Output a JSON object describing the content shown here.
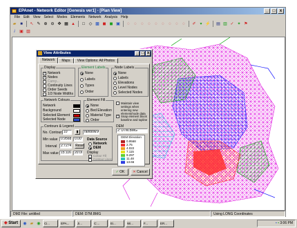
{
  "window": {
    "title": "EPAnet - Network Editor [Genesis ver1] - [Plan View]",
    "buttons": [
      "_",
      "□",
      "x"
    ]
  },
  "menu": [
    "File",
    "Edit",
    "View",
    "Select",
    "Modes",
    "Elements",
    "Network",
    "Analysis",
    "Help"
  ],
  "statusbar": {
    "file": "DM2 File: untitled",
    "dem": "DEM: D7M.BMG",
    "coords": "Using LONG Coordinates"
  },
  "taskbar": {
    "start": "Start",
    "tasks": [
      "Ci...",
      "EPA...",
      "Ji...",
      "C:...",
      "Ei...",
      "Wi...",
      "F...",
      "ER..."
    ],
    "clock": "3:06 PM"
  },
  "dialog": {
    "title": "View Attributes",
    "tabs": [
      "Network",
      "Maps",
      "View Options: All Photos"
    ],
    "display": {
      "label": "Display",
      "items": [
        {
          "label": "Network",
          "checked": true
        },
        {
          "label": "Nodes",
          "checked": true
        },
        {
          "label": "Curvy...",
          "checked": false
        },
        {
          "label": "Continuity Lines",
          "checked": false
        },
        {
          "label": "Order Seeds",
          "checked": false
        },
        {
          "label": "1/3 Node Widths",
          "checked": false
        }
      ]
    },
    "element_labels": {
      "label": "Element Labels",
      "items": [
        {
          "label": "None",
          "on": true
        },
        {
          "label": "Labels",
          "on": false
        },
        {
          "label": "Types",
          "on": false
        },
        {
          "label": "Order",
          "on": false
        }
      ]
    },
    "node_labels": {
      "label": "Node Labels",
      "items": [
        {
          "label": "None",
          "on": true
        },
        {
          "label": "Labels",
          "on": false
        },
        {
          "label": "Elevations",
          "on": false
        },
        {
          "label": "Level Nodes",
          "on": false
        },
        {
          "label": "Selected Nodes",
          "on": false
        }
      ]
    },
    "network_colours": {
      "label": "Network Colours",
      "items": [
        {
          "label": "Network",
          "color": "#000000"
        },
        {
          "label": "Background",
          "color": "#ffffff"
        },
        {
          "label": "Selected Element",
          "color": "#c00000"
        },
        {
          "label": "Selected Node",
          "color": "#3050d0"
        }
      ]
    },
    "element_fill": {
      "label": "Element Fill",
      "items": [
        {
          "label": "None",
          "on": true
        },
        {
          "label": "Bed Elevation",
          "on": false
        },
        {
          "label": "Material Type",
          "on": false
        },
        {
          "label": "Order",
          "on": false
        }
      ]
    },
    "maintain": "Maintain view settings when entering new element/node data",
    "snap": "Snap element block baseline and topline",
    "dem_label": "DEM",
    "dem_value": "2: D7M.BMG",
    "contours": {
      "label": "Contours & Legend",
      "no_contours_label": "No. Contours",
      "no_contours": "10",
      "min_value_label": "Min value",
      "min_value": "0.9568",
      "min_value2": "0.00",
      "interval_label": "Interval",
      "interval": "2.7274",
      "reset": "Reset",
      "max_value_label": "Max value",
      "max_value": "15.116",
      "max_value2": "20.00"
    },
    "rainbow_label": "rainbow.wsp",
    "data_source": {
      "label": "Data Source",
      "items": [
        {
          "label": "Network",
          "on": false
        },
        {
          "label": "DEM",
          "on": true
        }
      ]
    },
    "display2": {
      "label": "Display",
      "items": [
        "Colour Fill",
        "Contour Lines"
      ]
    },
    "legend": {
      "title": "DEM Elevation",
      "entries": [
        {
          "value": "0.9568",
          "color": "#b02020"
        },
        {
          "value": "2.75",
          "color": "#f03030"
        },
        {
          "value": "4.022",
          "color": "#f0a020"
        },
        {
          "value": "7.115",
          "color": "#e8e020"
        },
        {
          "value": "9.297",
          "color": "#60d030"
        },
        {
          "value": "11.48",
          "color": "#30c0c0"
        },
        {
          "value": "13.66",
          "color": "#3040e0"
        }
      ]
    },
    "ok": "OK",
    "cancel": "Cancel"
  },
  "colors": {
    "titlebar": "#0a246a",
    "face": "#d4d0c8",
    "map_magenta": "#e020e0",
    "map_red": "#ff2020",
    "map_green": "#00a000",
    "map_blue": "#2030ff",
    "map_cyan": "#20c0e0"
  }
}
